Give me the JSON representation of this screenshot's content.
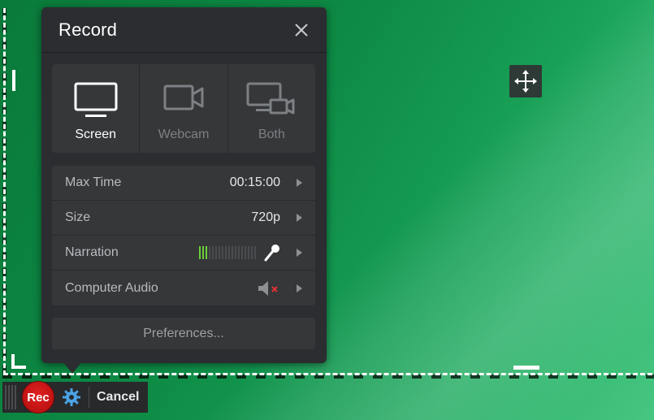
{
  "panel": {
    "title": "Record"
  },
  "sources": [
    {
      "label": "Screen",
      "icon": "monitor-icon",
      "active": true
    },
    {
      "label": "Webcam",
      "icon": "webcam-icon",
      "active": false
    },
    {
      "label": "Both",
      "icon": "monitor-webcam-icon",
      "active": false
    }
  ],
  "settings": {
    "max_time": {
      "label": "Max Time",
      "value": "00:15:00"
    },
    "size": {
      "label": "Size",
      "value": "720p"
    },
    "narration": {
      "label": "Narration",
      "level_fraction": 0.15
    },
    "computer_audio": {
      "label": "Computer Audio",
      "muted": true
    }
  },
  "preferences_label": "Preferences...",
  "toolbar": {
    "rec_label": "Rec",
    "cancel_label": "Cancel"
  },
  "colors": {
    "accent_rec": "#d31515",
    "meter_on": "#6cd23a",
    "gear": "#4aa3e6",
    "mute_x": "#e23030"
  }
}
